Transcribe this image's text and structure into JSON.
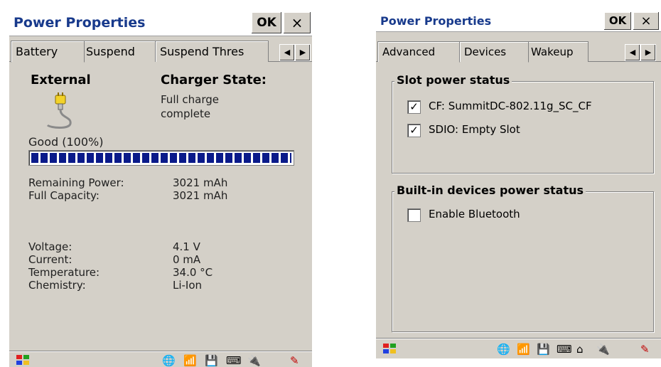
{
  "left": {
    "title": "Power Properties",
    "ok_label": "OK",
    "close_label": "×",
    "tabs": [
      "Battery",
      "Suspend",
      "Suspend Thres"
    ],
    "external_label": "External",
    "charger_state_label": "Charger State:",
    "charger_state_value_line1": "Full charge",
    "charger_state_value_line2": "complete",
    "battery_status": "Good  (100%)",
    "battery_level_percent": 100,
    "remaining_power_label": "Remaining Power:",
    "remaining_power_value": "3021 mAh",
    "full_capacity_label": "Full Capacity:",
    "full_capacity_value": "3021 mAh",
    "voltage_label": "Voltage:",
    "voltage_value": "4.1 V",
    "current_label": "Current:",
    "current_value": "0 mA",
    "temperature_label": "Temperature:",
    "temperature_value": "34.0 °C",
    "chemistry_label": "Chemistry:",
    "chemistry_value": "Li-Ion"
  },
  "right": {
    "title": "Power Properties",
    "ok_label": "OK",
    "close_label": "×",
    "tabs": [
      "Advanced",
      "Devices",
      "Wakeup"
    ],
    "slot_group_title": "Slot power status",
    "slot_items": [
      {
        "label": "CF: SummitDC-802.11g_SC_CF",
        "checked": true
      },
      {
        "label": "SDIO: Empty Slot",
        "checked": true
      }
    ],
    "builtin_group_title": "Built-in devices power status",
    "builtin_items": [
      {
        "label": "Enable Bluetooth",
        "checked": false
      }
    ]
  },
  "icons": {
    "start": "windows-flag-icon",
    "plug": "power-plug-icon",
    "pen": "stylus-pen-icon"
  },
  "colors": {
    "title_text": "#183a8c",
    "window_bg": "#d4d0c8",
    "bar_fill": "#0a1a8a"
  }
}
